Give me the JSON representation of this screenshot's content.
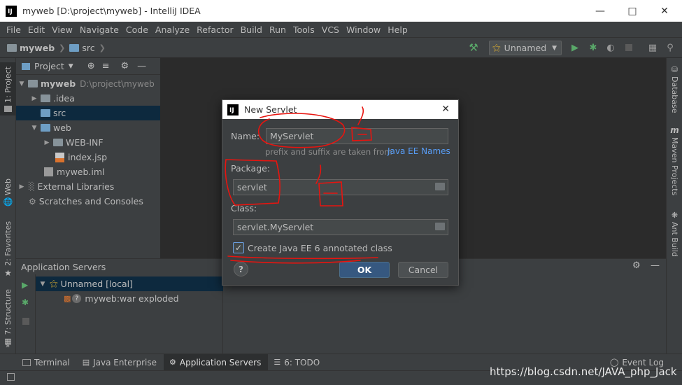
{
  "window": {
    "title": "myweb [D:\\project\\myweb] - IntelliJ IDEA",
    "app_icon_text": "IJ"
  },
  "menu": [
    "File",
    "Edit",
    "View",
    "Navigate",
    "Code",
    "Analyze",
    "Refactor",
    "Build",
    "Run",
    "Tools",
    "VCS",
    "Window",
    "Help"
  ],
  "breadcrumb": {
    "project": "myweb",
    "folder": "src"
  },
  "toolbar": {
    "run_config": "Unnamed"
  },
  "left_stripe": {
    "project_tab": "1: Project",
    "web_tab": "Web",
    "favorites_tab": "2: Favorites",
    "structure_tab": "7: Structure"
  },
  "right_stripe": {
    "database_tab": "Database",
    "maven_tab": "Maven Projects",
    "ant_tab": "Ant Build"
  },
  "project_panel": {
    "title": "Project",
    "tree": [
      {
        "label": "myweb",
        "extra": "D:\\project\\myweb"
      },
      {
        "label": ".idea"
      },
      {
        "label": "src"
      },
      {
        "label": "web"
      },
      {
        "label": "WEB-INF"
      },
      {
        "label": "index.jsp"
      },
      {
        "label": "myweb.iml"
      },
      {
        "label": "External Libraries"
      },
      {
        "label": "Scratches and Consoles"
      }
    ]
  },
  "app_servers": {
    "title": "Application Servers",
    "server": "Unnamed [local]",
    "artifact": "myweb:war exploded"
  },
  "tool_tabs": [
    {
      "label": "Terminal"
    },
    {
      "label": "Java Enterprise"
    },
    {
      "label": "Application Servers"
    },
    {
      "label": "6: TODO"
    }
  ],
  "event_log": "Event Log",
  "dialog": {
    "title": "New Servlet",
    "name_label": "Name:",
    "name_value": "MyServlet",
    "hint": "prefix and suffix are taken from",
    "hint_link": "Java EE Names",
    "package_label": "Package:",
    "package_value": "servlet",
    "class_label": "Class:",
    "class_value": "servlet.MyServlet",
    "checkbox_label": "Create Java EE 6 annotated class",
    "checkbox_checked": true,
    "ok": "OK",
    "cancel": "Cancel",
    "help": "?"
  },
  "watermark": "https://blog.csdn.net/JAVA_php_Jack",
  "colors": {
    "annotation_red": "#e8140f",
    "selection": "#0d293e",
    "ok_button": "#365880"
  }
}
